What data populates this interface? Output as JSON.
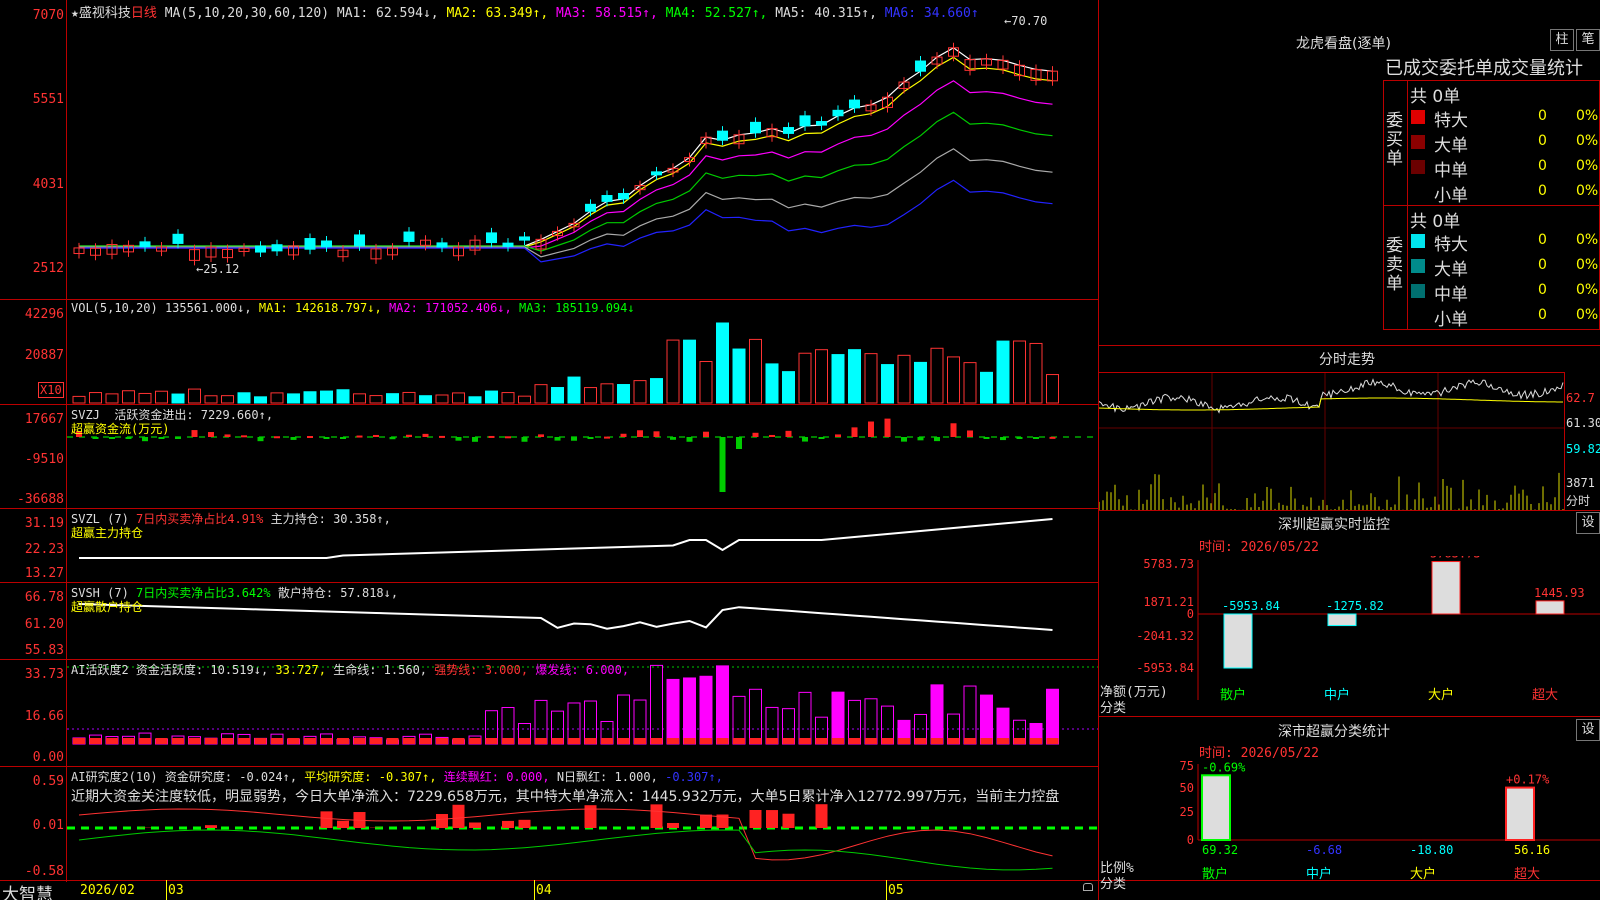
{
  "stock": {
    "star": "★",
    "name": "盛视科技",
    "period": "日线"
  },
  "ma": {
    "title": "MA(5,10,20,30,60,120)",
    "ma1": "MA1: 62.594↓,",
    "ma2": "MA2: 63.349↑,",
    "ma3": "MA3: 58.515↑,",
    "ma4": "MA4: 52.527↑,",
    "ma5": "MA5: 40.315↑,",
    "ma6": "MA6: 34.660↑",
    "hi": "←70.70",
    "lo": "←25.12",
    "ticks": [
      "7070",
      "5551",
      "4031",
      "2512"
    ]
  },
  "vol": {
    "title": "VOL(5,10,20)",
    "value": "135561.000↓,",
    "ma1": "MA1: 142618.797↓,",
    "ma2": "MA2: 171052.406↓,",
    "ma3": "MA3: 185119.094↓",
    "ticks": [
      "42296",
      "20887"
    ],
    "unit": "X10"
  },
  "svzj": {
    "title": "SVZJ",
    "desc": "活跃资金进出: 7229.660↑,",
    "sub": "超赢资金流(万元)",
    "ticks": [
      "17667",
      "-9510",
      "-36688"
    ]
  },
  "svzl": {
    "title": "SVZL (7)",
    "pct": "7日内买卖净占比4.91%",
    "hold": "主力持仓: 30.358↑,",
    "sub": "超赢主力持仓",
    "ticks": [
      "31.19",
      "22.23",
      "13.27"
    ]
  },
  "svsh": {
    "title": "SVSH (7)",
    "pct": "7日内买卖净占比3.642%",
    "hold": "散户持仓: 57.818↓,",
    "sub": "超赢散户持仓",
    "ticks": [
      "66.78",
      "61.20",
      "55.83"
    ]
  },
  "ai1": {
    "title": "AI活跃度2",
    "a": "资金活跃度: 10.519↓,",
    "b": "33.727,",
    "c": "生命线: 1.560,",
    "d": "强势线: 3.000,",
    "e": "爆发线: 6.000,",
    "ticks": [
      "33.73",
      "16.66",
      "0.00"
    ]
  },
  "ai2": {
    "title": "AI研究度2(10)",
    "a": "资金研究度: -0.024↑,",
    "b": "平均研究度: -0.307↑,",
    "c": "连续飘红: 0.000,",
    "d": "N日飘红: 1.000,",
    "e": "-0.307↑,",
    "text": "近期大资金关注度较低，明显弱势，今日大单净流入：7229.658万元，其中特大单净流入：1445.932万元，大单5日累计净入12772.997万元，当前主力控盘",
    "ticks": [
      "0.59",
      "0.01",
      "-0.58"
    ]
  },
  "footer": {
    "brand": "大智慧",
    "d1": "2026/02",
    "d2": "03",
    "d3": "04",
    "d4": "05"
  },
  "lhb": {
    "title": "龙虎看盘(逐单)",
    "btn1": "柱",
    "btn2": "笔",
    "tabs": "已成交委托单成交量统计",
    "buy": {
      "side": "委买单",
      "total": "共 0单",
      "rows": [
        {
          "label": "特大",
          "n": "0",
          "p": "0%",
          "color": "#e00000"
        },
        {
          "label": "大单",
          "n": "0",
          "p": "0%",
          "color": "#8b0000"
        },
        {
          "label": "中单",
          "n": "0",
          "p": "0%",
          "color": "#6b0000"
        },
        {
          "label": "小单",
          "n": "0",
          "p": "0%",
          "color": "#000000"
        }
      ]
    },
    "sell": {
      "side": "委卖单",
      "total": "共 0单",
      "rows": [
        {
          "label": "特大",
          "n": "0",
          "p": "0%",
          "color": "#00e5ee"
        },
        {
          "label": "大单",
          "n": "0",
          "p": "0%",
          "color": "#008b8b"
        },
        {
          "label": "中单",
          "n": "0",
          "p": "0%",
          "color": "#007070"
        },
        {
          "label": "小单",
          "n": "0",
          "p": "0%",
          "color": "#000000"
        }
      ]
    }
  },
  "fs": {
    "title": "分时走势",
    "p1": "62.7",
    "p2": "61.30",
    "p3": "59.82",
    "vol": "3871",
    "unit": "分时"
  },
  "sz": {
    "title": "深圳超赢实时监控",
    "btn": "设",
    "date": "时间: 2026/05/22",
    "ticks": [
      "5783.73",
      "1871.21",
      "0",
      "-2041.32",
      "-5953.84"
    ],
    "ylabel": "净额(万元)",
    "xlabel": "分类",
    "chart_data": {
      "type": "bar",
      "categories": [
        "散户",
        "中户",
        "大户",
        "超大"
      ],
      "values": [
        -5953.84,
        -1275.82,
        5783.73,
        1445.93
      ],
      "ylim": [
        -5953.84,
        5783.73
      ]
    }
  },
  "szs": {
    "title": "深市超赢分类统计",
    "btn": "设",
    "date": "时间: 2026/05/22",
    "ticks": [
      "75",
      "50",
      "25",
      "0"
    ],
    "ylabel": "比例%",
    "xlabel": "分类",
    "chart_data": {
      "type": "bar",
      "categories": [
        "散户",
        "中户",
        "大户",
        "超大"
      ],
      "values": [
        69.32,
        -6.68,
        -18.8,
        56.16
      ],
      "changes": [
        "-0.69%",
        "",
        "",
        "+0.17%"
      ],
      "ylim": [
        0,
        75
      ]
    }
  }
}
